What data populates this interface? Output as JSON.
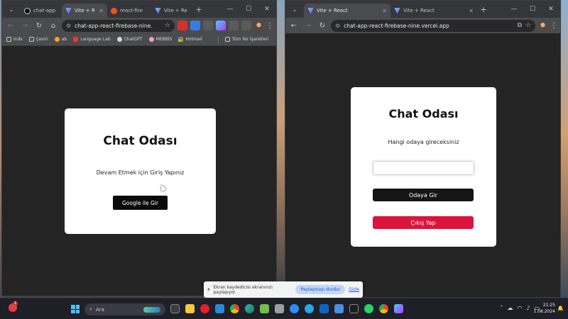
{
  "left_window": {
    "tabs": [
      {
        "label": "chat-app",
        "icon": "github-icon",
        "active": false
      },
      {
        "label": "Vite + Re",
        "icon": "vite-icon",
        "active": true
      },
      {
        "label": "react-fire",
        "icon": "firebase-icon",
        "active": false
      },
      {
        "label": "Vite + Re",
        "icon": "vite-icon",
        "active": false
      }
    ],
    "url": "chat-app-react-firebase-nine.",
    "bookmarks": [
      "Inds",
      "Çeviri",
      "ab",
      "Language Lab",
      "ChatGPT",
      "MEBBİS",
      "Hotmail"
    ],
    "all_bookmarks": "Tüm Yer İşaretleri",
    "card": {
      "title": "Chat Odası",
      "message": "Devam Etmek için Giriş Yapınız",
      "button_label": "Google ile Gir"
    }
  },
  "right_window": {
    "tabs": [
      {
        "label": "Vite + React",
        "icon": "vite-icon",
        "active": true
      },
      {
        "label": "Vite + React",
        "icon": "vite-icon",
        "active": false
      }
    ],
    "url": "chat-app-react-firebase-nine.vercel.app",
    "card": {
      "title": "Chat Odası",
      "message": "Hangi odaya gireceksiniz",
      "input_value": "",
      "enter_button_label": "Odaya Gir",
      "logout_button_label": "Çıkış Yap"
    }
  },
  "share_bar": {
    "message": "Ekran kaydedicisi ekranınızı paylaşıyor.",
    "stop_label": "Paylaşmayı durdur",
    "hide_label": "Gizle"
  },
  "taskbar": {
    "search_placeholder": "Ara",
    "notification_count": "1",
    "time": "21:25",
    "date": "1.08.2024"
  },
  "colors": {
    "logout_button": "#dc143c",
    "primary_button": "#151515",
    "card_background": "#ffffff",
    "page_background": "#242424"
  }
}
